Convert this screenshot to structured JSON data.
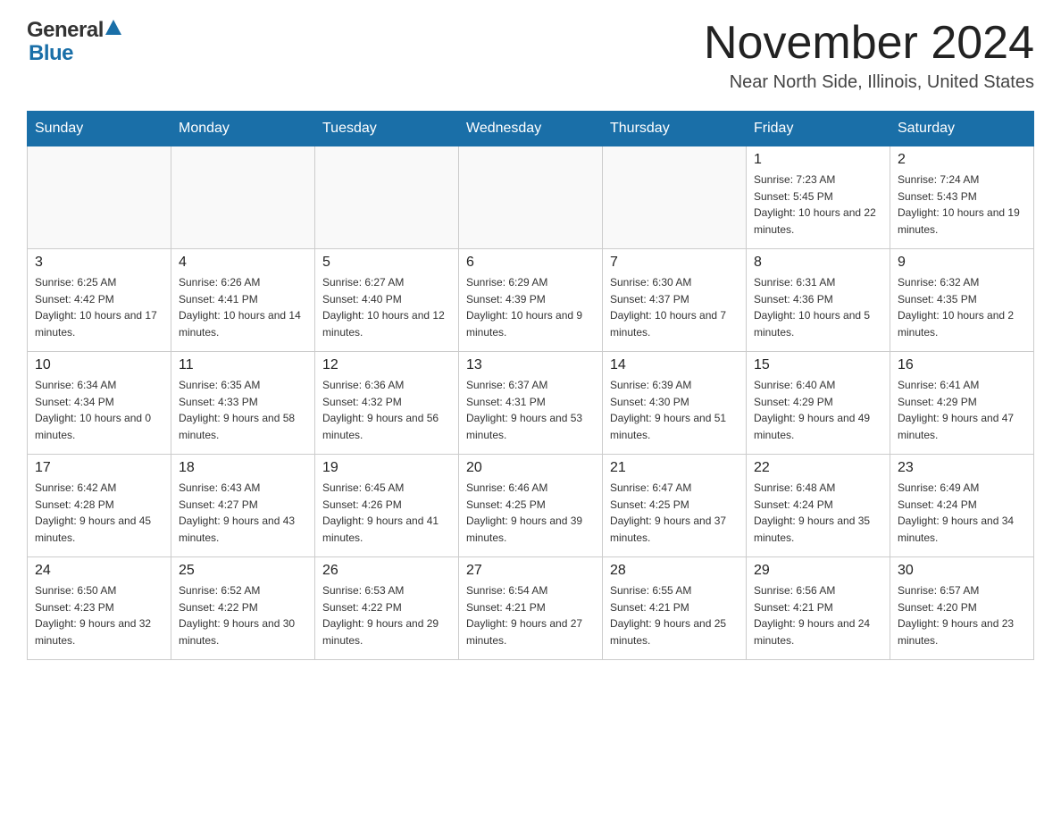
{
  "header": {
    "logo_general": "General",
    "logo_blue": "Blue",
    "title": "November 2024",
    "subtitle": "Near North Side, Illinois, United States"
  },
  "weekdays": [
    "Sunday",
    "Monday",
    "Tuesday",
    "Wednesday",
    "Thursday",
    "Friday",
    "Saturday"
  ],
  "weeks": [
    [
      {
        "day": "",
        "sunrise": "",
        "sunset": "",
        "daylight": ""
      },
      {
        "day": "",
        "sunrise": "",
        "sunset": "",
        "daylight": ""
      },
      {
        "day": "",
        "sunrise": "",
        "sunset": "",
        "daylight": ""
      },
      {
        "day": "",
        "sunrise": "",
        "sunset": "",
        "daylight": ""
      },
      {
        "day": "",
        "sunrise": "",
        "sunset": "",
        "daylight": ""
      },
      {
        "day": "1",
        "sunrise": "Sunrise: 7:23 AM",
        "sunset": "Sunset: 5:45 PM",
        "daylight": "Daylight: 10 hours and 22 minutes."
      },
      {
        "day": "2",
        "sunrise": "Sunrise: 7:24 AM",
        "sunset": "Sunset: 5:43 PM",
        "daylight": "Daylight: 10 hours and 19 minutes."
      }
    ],
    [
      {
        "day": "3",
        "sunrise": "Sunrise: 6:25 AM",
        "sunset": "Sunset: 4:42 PM",
        "daylight": "Daylight: 10 hours and 17 minutes."
      },
      {
        "day": "4",
        "sunrise": "Sunrise: 6:26 AM",
        "sunset": "Sunset: 4:41 PM",
        "daylight": "Daylight: 10 hours and 14 minutes."
      },
      {
        "day": "5",
        "sunrise": "Sunrise: 6:27 AM",
        "sunset": "Sunset: 4:40 PM",
        "daylight": "Daylight: 10 hours and 12 minutes."
      },
      {
        "day": "6",
        "sunrise": "Sunrise: 6:29 AM",
        "sunset": "Sunset: 4:39 PM",
        "daylight": "Daylight: 10 hours and 9 minutes."
      },
      {
        "day": "7",
        "sunrise": "Sunrise: 6:30 AM",
        "sunset": "Sunset: 4:37 PM",
        "daylight": "Daylight: 10 hours and 7 minutes."
      },
      {
        "day": "8",
        "sunrise": "Sunrise: 6:31 AM",
        "sunset": "Sunset: 4:36 PM",
        "daylight": "Daylight: 10 hours and 5 minutes."
      },
      {
        "day": "9",
        "sunrise": "Sunrise: 6:32 AM",
        "sunset": "Sunset: 4:35 PM",
        "daylight": "Daylight: 10 hours and 2 minutes."
      }
    ],
    [
      {
        "day": "10",
        "sunrise": "Sunrise: 6:34 AM",
        "sunset": "Sunset: 4:34 PM",
        "daylight": "Daylight: 10 hours and 0 minutes."
      },
      {
        "day": "11",
        "sunrise": "Sunrise: 6:35 AM",
        "sunset": "Sunset: 4:33 PM",
        "daylight": "Daylight: 9 hours and 58 minutes."
      },
      {
        "day": "12",
        "sunrise": "Sunrise: 6:36 AM",
        "sunset": "Sunset: 4:32 PM",
        "daylight": "Daylight: 9 hours and 56 minutes."
      },
      {
        "day": "13",
        "sunrise": "Sunrise: 6:37 AM",
        "sunset": "Sunset: 4:31 PM",
        "daylight": "Daylight: 9 hours and 53 minutes."
      },
      {
        "day": "14",
        "sunrise": "Sunrise: 6:39 AM",
        "sunset": "Sunset: 4:30 PM",
        "daylight": "Daylight: 9 hours and 51 minutes."
      },
      {
        "day": "15",
        "sunrise": "Sunrise: 6:40 AM",
        "sunset": "Sunset: 4:29 PM",
        "daylight": "Daylight: 9 hours and 49 minutes."
      },
      {
        "day": "16",
        "sunrise": "Sunrise: 6:41 AM",
        "sunset": "Sunset: 4:29 PM",
        "daylight": "Daylight: 9 hours and 47 minutes."
      }
    ],
    [
      {
        "day": "17",
        "sunrise": "Sunrise: 6:42 AM",
        "sunset": "Sunset: 4:28 PM",
        "daylight": "Daylight: 9 hours and 45 minutes."
      },
      {
        "day": "18",
        "sunrise": "Sunrise: 6:43 AM",
        "sunset": "Sunset: 4:27 PM",
        "daylight": "Daylight: 9 hours and 43 minutes."
      },
      {
        "day": "19",
        "sunrise": "Sunrise: 6:45 AM",
        "sunset": "Sunset: 4:26 PM",
        "daylight": "Daylight: 9 hours and 41 minutes."
      },
      {
        "day": "20",
        "sunrise": "Sunrise: 6:46 AM",
        "sunset": "Sunset: 4:25 PM",
        "daylight": "Daylight: 9 hours and 39 minutes."
      },
      {
        "day": "21",
        "sunrise": "Sunrise: 6:47 AM",
        "sunset": "Sunset: 4:25 PM",
        "daylight": "Daylight: 9 hours and 37 minutes."
      },
      {
        "day": "22",
        "sunrise": "Sunrise: 6:48 AM",
        "sunset": "Sunset: 4:24 PM",
        "daylight": "Daylight: 9 hours and 35 minutes."
      },
      {
        "day": "23",
        "sunrise": "Sunrise: 6:49 AM",
        "sunset": "Sunset: 4:24 PM",
        "daylight": "Daylight: 9 hours and 34 minutes."
      }
    ],
    [
      {
        "day": "24",
        "sunrise": "Sunrise: 6:50 AM",
        "sunset": "Sunset: 4:23 PM",
        "daylight": "Daylight: 9 hours and 32 minutes."
      },
      {
        "day": "25",
        "sunrise": "Sunrise: 6:52 AM",
        "sunset": "Sunset: 4:22 PM",
        "daylight": "Daylight: 9 hours and 30 minutes."
      },
      {
        "day": "26",
        "sunrise": "Sunrise: 6:53 AM",
        "sunset": "Sunset: 4:22 PM",
        "daylight": "Daylight: 9 hours and 29 minutes."
      },
      {
        "day": "27",
        "sunrise": "Sunrise: 6:54 AM",
        "sunset": "Sunset: 4:21 PM",
        "daylight": "Daylight: 9 hours and 27 minutes."
      },
      {
        "day": "28",
        "sunrise": "Sunrise: 6:55 AM",
        "sunset": "Sunset: 4:21 PM",
        "daylight": "Daylight: 9 hours and 25 minutes."
      },
      {
        "day": "29",
        "sunrise": "Sunrise: 6:56 AM",
        "sunset": "Sunset: 4:21 PM",
        "daylight": "Daylight: 9 hours and 24 minutes."
      },
      {
        "day": "30",
        "sunrise": "Sunrise: 6:57 AM",
        "sunset": "Sunset: 4:20 PM",
        "daylight": "Daylight: 9 hours and 23 minutes."
      }
    ]
  ]
}
